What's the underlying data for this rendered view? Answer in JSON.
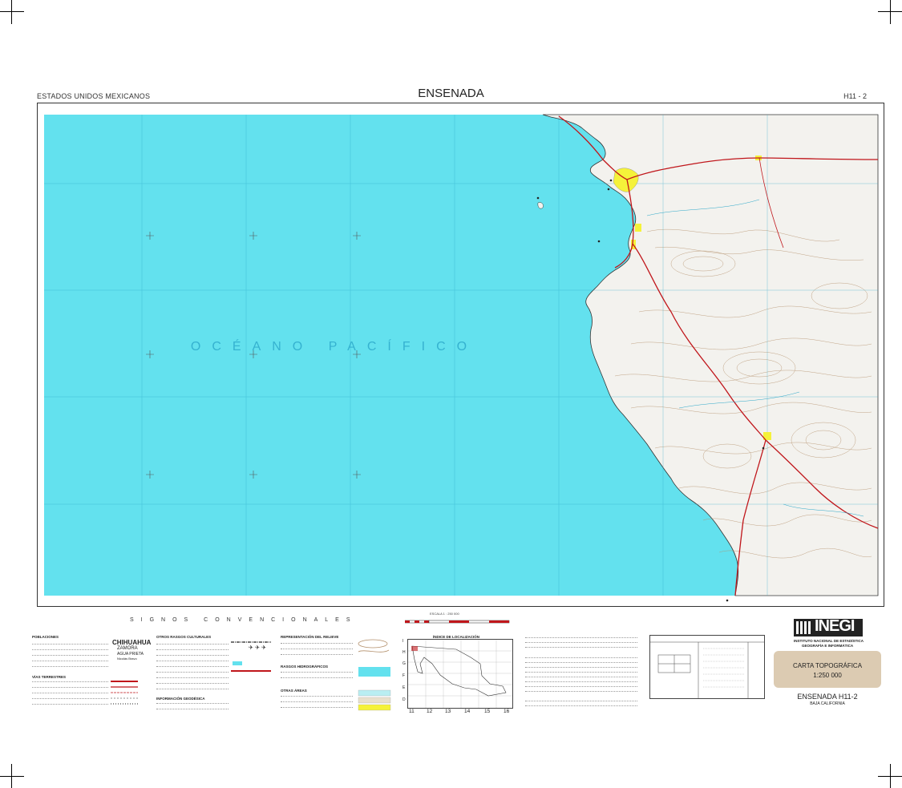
{
  "header": {
    "left": "ESTADOS UNIDOS MEXICANOS",
    "title": "ENSENADA",
    "right": "H11 - 2"
  },
  "map": {
    "ocean_label": "OCÉANO PACÍFICO",
    "colors": {
      "ocean": "#63e1ee",
      "land": "#f4f4f2",
      "urban": "#f5f23a",
      "road": "#c0161b",
      "contour": "#b38f6a",
      "grid": "#2aa7c9"
    }
  },
  "legend": {
    "signos": "SIGNOS CONVENCIONALES",
    "col1": {
      "poblaciones": "POBLACIONES",
      "sample_big": "CHIHUAHUA",
      "sample_mid": "ZAMORA",
      "sample_small": "AGUA PRIETA",
      "sample_tiny": "Nicolás Bravo",
      "vias": "VÍAS TERRESTRES"
    },
    "col2": {
      "otros": "OTROS RASGOS CULTURALES",
      "geodesica": "INFORMACIÓN GEODÉSICA"
    },
    "col3": {
      "relieve": "REPRESENTACIÓN DEL RELIEVE",
      "hidro": "RASGOS HIDROGRÁFICOS",
      "areas": "OTRAS ÁREAS"
    },
    "escala": "ESCALA 1 : 250 000",
    "indice": "ÍNDICE DE LOCALIZACIÓN",
    "indice_cols": [
      "11",
      "12",
      "13",
      "14",
      "15",
      "16"
    ],
    "indice_rows": [
      "I",
      "H",
      "G",
      "F",
      "E",
      "D"
    ]
  },
  "brand": {
    "logo": "INEGI",
    "sub1": "INSTITUTO NACIONAL DE ESTADÍSTICA",
    "sub2": "GEOGRAFÍA E INFORMÁTICA",
    "carta": "CARTA TOPOGRÁFICA",
    "scale": "1:250 000",
    "sheet": "ENSENADA H11-2",
    "state": "BAJA CALIFORNIA"
  }
}
